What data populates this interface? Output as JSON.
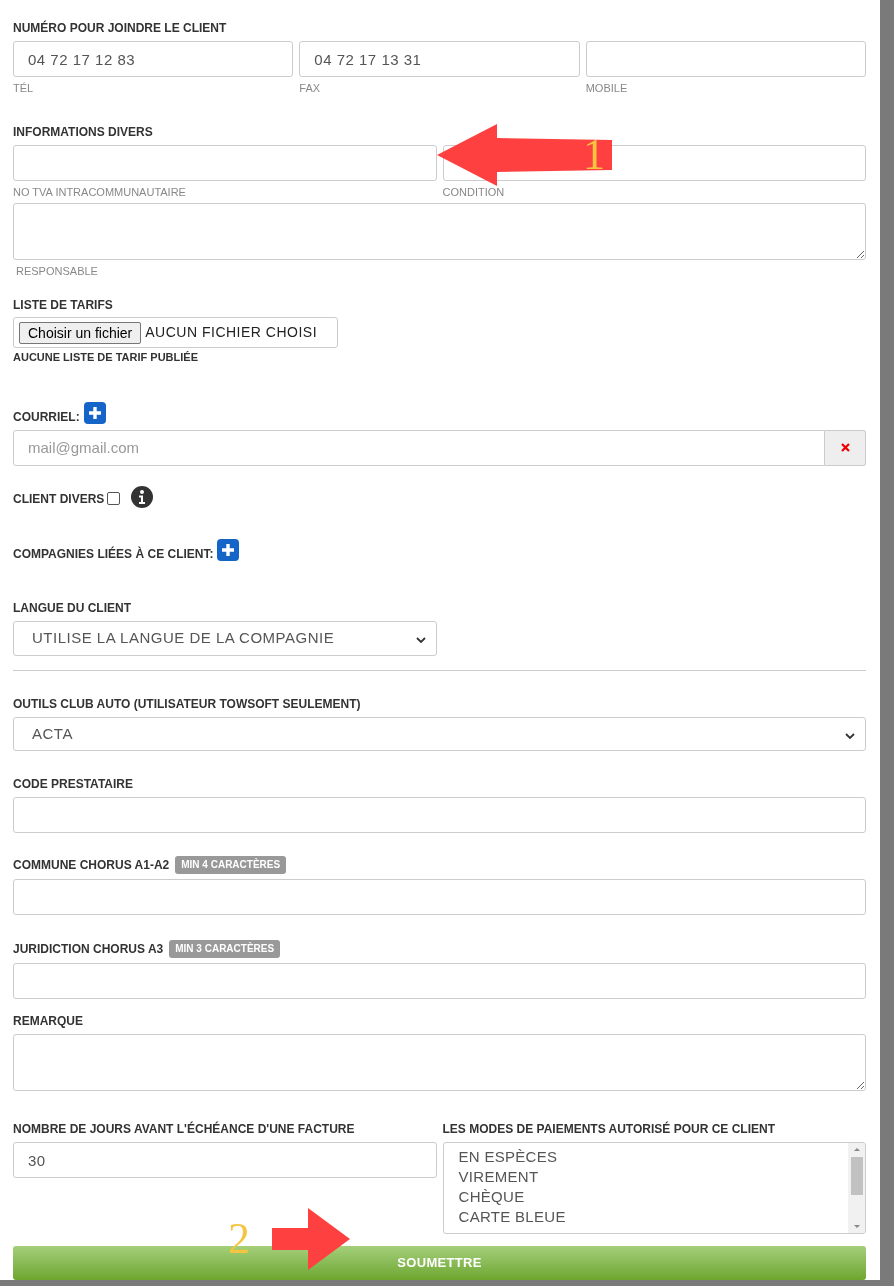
{
  "phone": {
    "label": "NUMÉRO POUR JOINDRE LE CLIENT",
    "fields": [
      {
        "value": "04 72 17 12 83",
        "caption": "TÉL"
      },
      {
        "value": "04 72 17 13 31",
        "caption": "FAX"
      },
      {
        "caption": "MOBILE"
      }
    ]
  },
  "info": {
    "label": "INFORMATIONS DIVERS",
    "fields": [
      {
        "caption": "NO TVA INTRACOMMUNAUTAIRE"
      },
      {
        "caption": "CONDITION"
      }
    ],
    "notes_caption": "RESPONSABLE"
  },
  "tariffs": {
    "label": "LISTE DE TARIFS",
    "button": "Choisir un fichier",
    "file_status": "AUCUN FICHIER CHOISI",
    "note": "AUCUNE LISTE DE TARIF PUBLIÉE"
  },
  "email": {
    "label": "COURRIEL:",
    "placeholder": "mail@gmail.com"
  },
  "client_divers": {
    "label": "CLIENT DIVERS",
    "checked": false
  },
  "companies": {
    "label": "COMPAGNIES LIÉES À CE CLIENT:"
  },
  "language": {
    "label": "LANGUE DU CLIENT",
    "value": "UTILISE LA LANGUE DE LA COMPAGNIE"
  },
  "club_tools": {
    "label": "OUTILS CLUB AUTO (UTILISATEUR TOWSOFT SEULEMENT)",
    "value": "ACTA"
  },
  "code_prestataire": {
    "label": "CODE PRESTATAIRE"
  },
  "commune": {
    "label": "COMMUNE CHORUS A1-A2",
    "badge": "MIN 4 CARACTÈRES"
  },
  "juridiction": {
    "label": "JURIDICTION CHORUS A3",
    "badge": "MIN 3 CARACTÈRES"
  },
  "remark": {
    "label": "REMARQUE"
  },
  "days": {
    "label": "NOMBRE DE JOURS AVANT L'ÉCHÉANCE D'UNE FACTURE",
    "value": "30"
  },
  "payment_modes": {
    "label": "LES MODES DE PAIEMENTS AUTORISÉ POUR CE CLIENT",
    "options": [
      "EN ESPÈCES",
      "VIREMENT",
      "CHÈQUE",
      "CARTE BLEUE"
    ]
  },
  "submit": "SOUMETTRE",
  "annotations": [
    {
      "number": "1"
    },
    {
      "number": "2"
    }
  ]
}
